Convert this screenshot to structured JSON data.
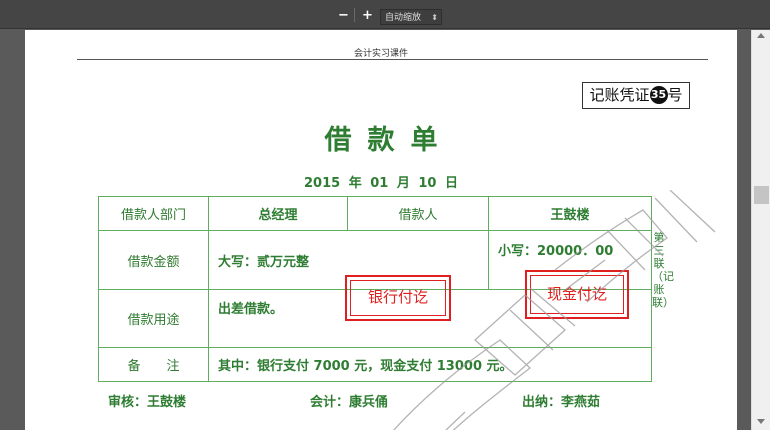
{
  "toolbar": {
    "zoom_out_label": "−",
    "zoom_in_label": "+",
    "zoom_select_label": "自动缩放",
    "zoom_select_arrow": "⬍"
  },
  "page": {
    "header_text": "会计实习课件",
    "voucher": {
      "prefix": "记账凭证",
      "number": "35",
      "suffix": "号"
    },
    "title": "借款单",
    "date": "2015 年 01 月 10 日",
    "table": {
      "dept_label": "借款人部门",
      "dept_value": "总经理",
      "borrower_label": "借款人",
      "borrower_value": "王鼓楼",
      "amount_label": "借款金额",
      "amount_upper": "大写：贰万元整",
      "amount_lower": "小写：20000．00",
      "purpose_label": "借款用途",
      "purpose_value": "出差借款。",
      "remark_label": "备　　注",
      "remark_value": "其中：银行支付 7000 元，现金支付 13000 元。"
    },
    "stamps": {
      "bank": "银行付讫",
      "cash": "现金付讫"
    },
    "side_note": "第三联（记账联）",
    "footer": {
      "reviewer": "审核：王鼓楼",
      "accountant": "会计：康兵俑",
      "cashier": "出纳：李燕茹"
    }
  }
}
